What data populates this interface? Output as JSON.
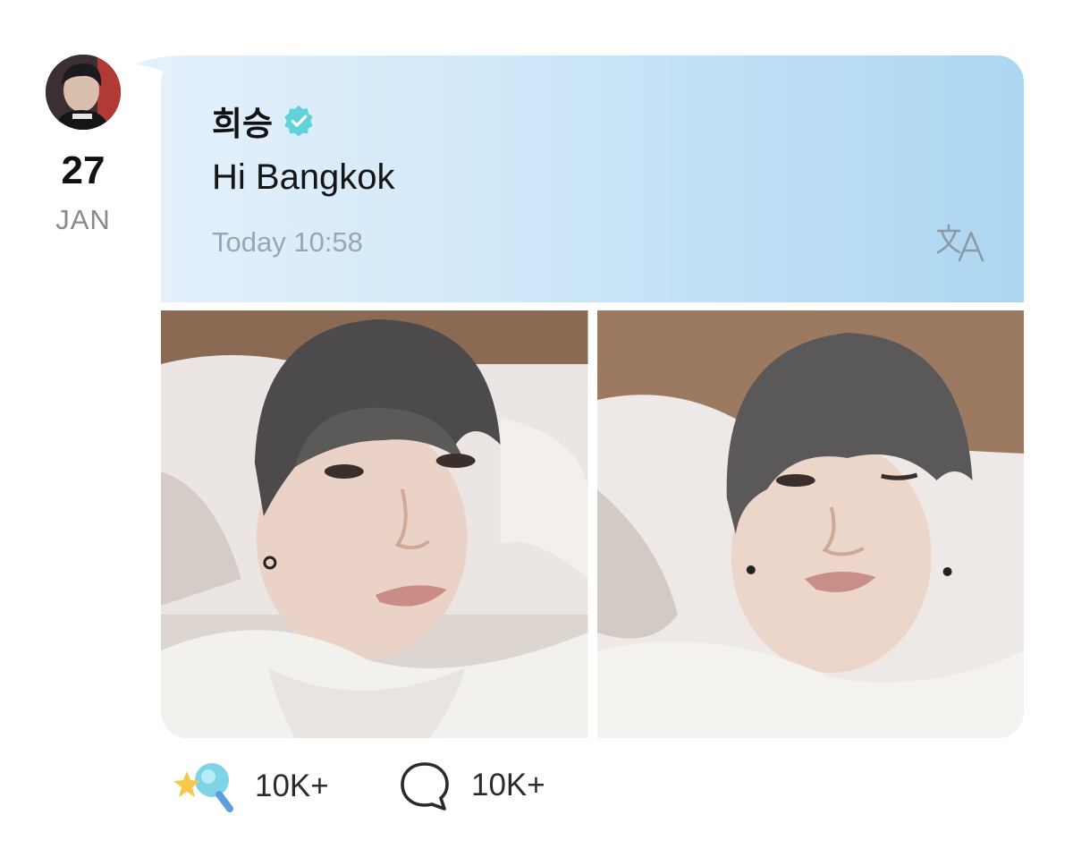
{
  "post": {
    "author": "희승",
    "message": "Hi Bangkok",
    "timestamp": "Today 10:58",
    "date_day": "27",
    "date_month": "JAN",
    "verified_color": "#5fd3d8",
    "bubble_gradient": [
      "#e4f1fb",
      "#acd6f1"
    ]
  },
  "photos": [
    {
      "description_icon": "selfie-photo"
    },
    {
      "description_icon": "selfie-photo"
    }
  ],
  "reactions": {
    "likes": "10K+",
    "comments": "10K+"
  },
  "icons": {
    "translate": "translate-icon",
    "like": "star-lightstick-icon",
    "comment": "speech-bubble-icon",
    "verified": "verified-badge-icon"
  }
}
